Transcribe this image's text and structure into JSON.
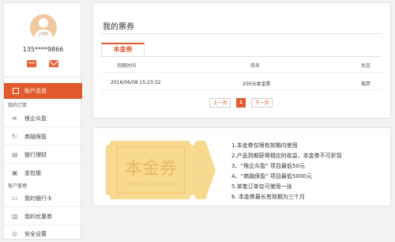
{
  "sidebar": {
    "avatar_text": "JYM",
    "phone": "135****9866",
    "active_item": "账户总览",
    "group_orders": "我的订单",
    "orders": [
      "根企众盈",
      "商融保盈",
      "银行理财",
      "金包银"
    ],
    "group_account": "账户管理",
    "account": [
      "我的银行卡",
      "我的优惠券",
      "安全设置"
    ]
  },
  "main": {
    "title": "我的票券",
    "tab": "本金券",
    "columns": {
      "expire": "到期时间",
      "name": "券名",
      "status": "状态"
    },
    "row": {
      "expire": "2016/06/08 15:23:32",
      "name": "200元本金券",
      "status": "效弃"
    },
    "pagination": {
      "prev": "上一页",
      "current": "1",
      "next": "下一页"
    }
  },
  "coupon": {
    "title": "本金券",
    "subtitle": "PRINCIPAL COUPONS",
    "rules": [
      "1.本金券仅限有效期内使用",
      "2.产品到期获得相应的收益，本金券不可折现",
      "3、“根企众盈” 项目最低50元",
      "4、“商融保盈” 项目最低5000元",
      "5.单笔订单仅可使用一张",
      "6. 本金券最长有效期为三个月"
    ]
  },
  "colors": {
    "accent": "#e05a2e",
    "coupon_bg": "#f7d98f",
    "coupon_text": "#e9b865"
  }
}
